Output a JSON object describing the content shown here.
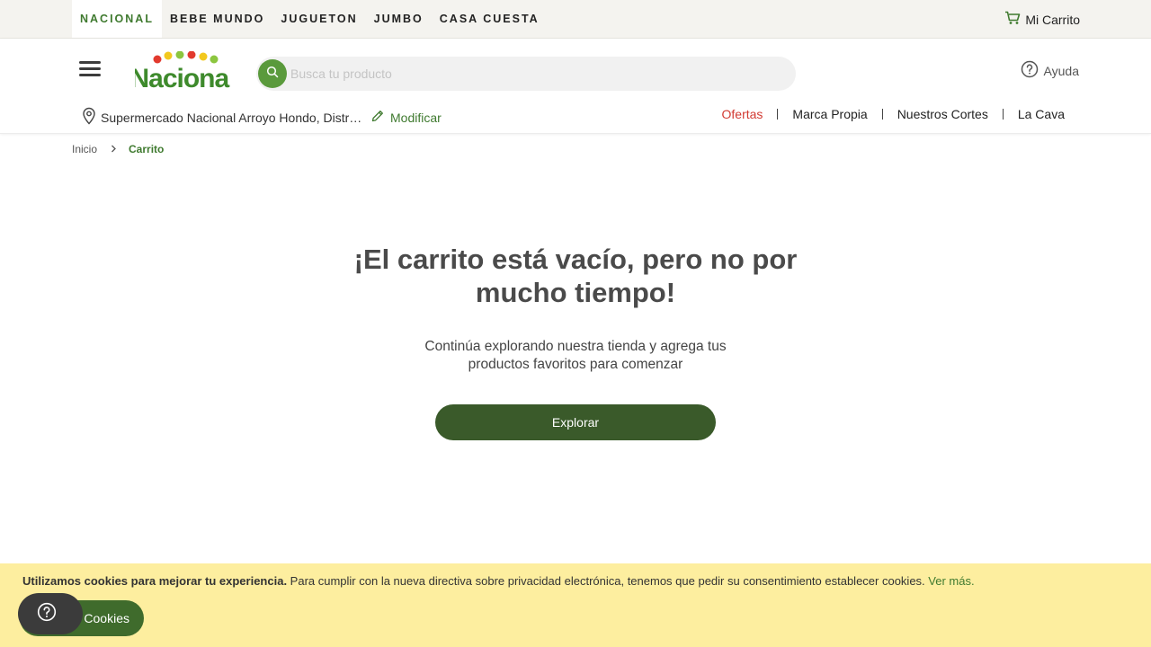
{
  "brand_tabs": [
    "NACIONAL",
    "BEBE MUNDO",
    "JUGUETON",
    "JUMBO",
    "CASA CUESTA"
  ],
  "cart_link": "Mi Carrito",
  "logo_text": "Nacional",
  "search": {
    "placeholder": "Busca tu producto"
  },
  "help_label": "Ayuda",
  "store": {
    "name": "Supermercado Nacional Arroyo Hondo, Distrito Nacional",
    "modify_label": "Modificar"
  },
  "quick_links": [
    "Ofertas",
    "Marca Propia",
    "Nuestros Cortes",
    "La Cava"
  ],
  "breadcrumb": {
    "home": "Inicio",
    "current": "Carrito"
  },
  "empty": {
    "title_line1": "¡El carrito está vacío, pero no por",
    "title_line2": "mucho tiempo!",
    "subtitle_line1": "Continúa explorando nuestra tienda y agrega tus",
    "subtitle_line2": "productos favoritos para comenzar",
    "button": "Explorar"
  },
  "cookies": {
    "bold": "Utilizamos cookies para mejorar tu experiencia.",
    "text": " Para cumplir con la nueva directiva sobre privacidad electrónica, tenemos que pedir su consentimiento establecer cookies. ",
    "more": "Ver más.",
    "button": "Cookies"
  },
  "colors": {
    "brand_green": "#3f7a2f",
    "dark_green": "#3a5a2a",
    "offers_red": "#d23a32",
    "cookie_bg": "#fdee9f",
    "topbar_bg": "#f4f3ef"
  },
  "icons": [
    "cart-icon",
    "menu-icon",
    "search-icon",
    "help-circle-icon",
    "location-pin-icon",
    "pencil-icon",
    "chevron-right-icon",
    "question-icon"
  ]
}
